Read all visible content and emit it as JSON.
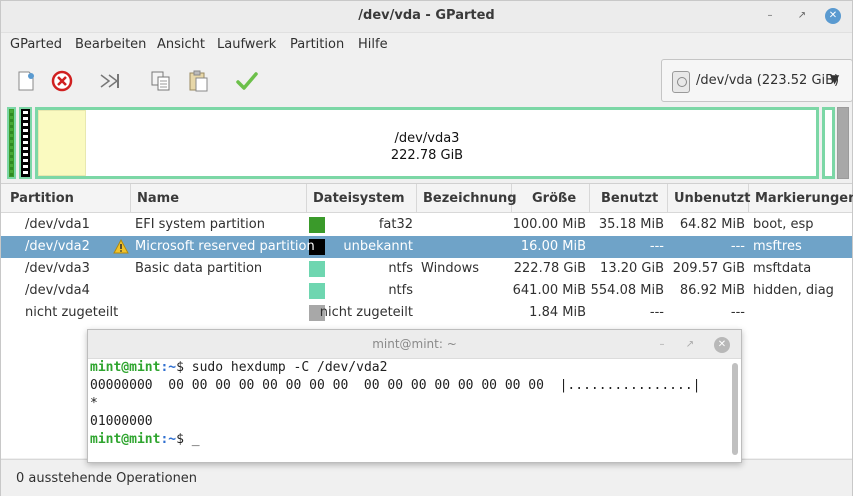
{
  "window": {
    "title": "/dev/vda - GParted"
  },
  "menu": [
    "GParted",
    "Bearbeiten",
    "Ansicht",
    "Laufwerk",
    "Partition",
    "Hilfe"
  ],
  "toolbar": {
    "icons": [
      "new-icon",
      "delete-icon",
      "resize-move-icon",
      "copy-icon",
      "paste-icon",
      "apply-icon"
    ]
  },
  "device": {
    "label": "/dev/vda  (223.52 GiB)"
  },
  "diskmap": {
    "main_name": "/dev/vda3",
    "main_size": "222.78 GiB"
  },
  "columns": [
    "Partition",
    "Name",
    "Dateisystem",
    "Bezeichnung",
    "Größe",
    "Benutzt",
    "Unbenutzt",
    "Markierungen"
  ],
  "rows": [
    {
      "partition": "/dev/vda1",
      "name": "EFI system partition",
      "fs": "fat32",
      "label": "",
      "size": "100.00 MiB",
      "used": "35.18 MiB",
      "unused": "64.82 MiB",
      "flags": "boot, esp",
      "color": "#3a9a2a",
      "warning": false
    },
    {
      "partition": "/dev/vda2",
      "name": "Microsoft reserved partition",
      "fs": "unbekannt",
      "label": "",
      "size": "16.00 MiB",
      "used": "---",
      "unused": "---",
      "flags": "msftres",
      "color": "#000000",
      "warning": true
    },
    {
      "partition": "/dev/vda3",
      "name": "Basic data partition",
      "fs": "ntfs",
      "label": "Windows",
      "size": "222.78 GiB",
      "used": "13.20 GiB",
      "unused": "209.57 GiB",
      "flags": "msftdata",
      "color": "#6ed6b0",
      "warning": false
    },
    {
      "partition": "/dev/vda4",
      "name": "",
      "fs": "ntfs",
      "label": "",
      "size": "641.00 MiB",
      "used": "554.08 MiB",
      "unused": "86.92 MiB",
      "flags": "hidden, diag",
      "color": "#6ed6b0",
      "warning": false
    },
    {
      "partition": "nicht zugeteilt",
      "name": "",
      "fs": "nicht zugeteilt",
      "label": "",
      "size": "1.84 MiB",
      "used": "---",
      "unused": "---",
      "flags": "",
      "color": "#a8a8a8",
      "warning": false
    }
  ],
  "status": {
    "text": "0 ausstehende Operationen"
  },
  "terminal": {
    "title": "mint@mint: ~",
    "prompt_user": "mint@mint",
    "prompt_path": ":~",
    "prompt_sym": "$ ",
    "command": "sudo hexdump -C /dev/vda2",
    "out1": "00000000  00 00 00 00 00 00 00 00  00 00 00 00 00 00 00 00  |................|",
    "out2": "*",
    "out3": "01000000",
    "cursor": "_"
  },
  "colors": {
    "accent": "#6fa3c8",
    "ntfs": "#6ed6b0",
    "fat32": "#3a9a2a",
    "prompt_user": "#2fa52f",
    "prompt_path": "#2f6fd0"
  }
}
